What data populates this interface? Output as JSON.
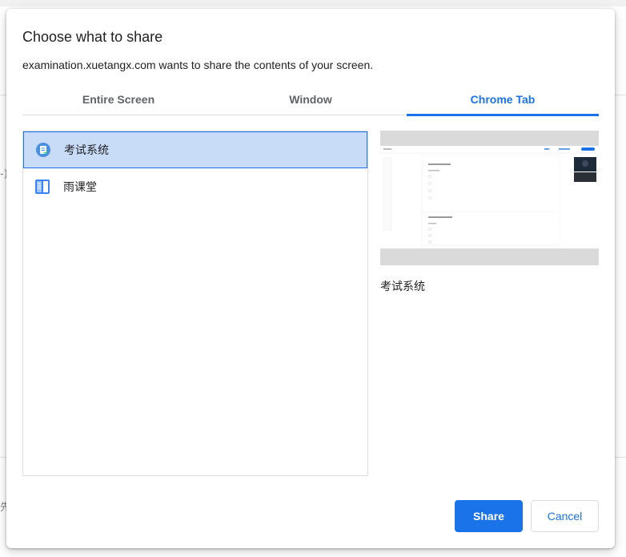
{
  "dialog": {
    "title": "Choose what to share",
    "subtitle": "examination.xuetangx.com wants to share the contents of your screen."
  },
  "tabs": [
    {
      "label": "Entire Screen",
      "active": false
    },
    {
      "label": "Window",
      "active": false
    },
    {
      "label": "Chrome Tab",
      "active": true
    }
  ],
  "list": {
    "items": [
      {
        "label": "考试系统",
        "icon": "exam-system-icon",
        "selected": true
      },
      {
        "label": "雨课堂",
        "icon": "rain-classroom-icon",
        "selected": false
      }
    ]
  },
  "preview": {
    "label": "考试系统"
  },
  "buttons": {
    "share": "Share",
    "cancel": "Cancel"
  },
  "background": {
    "fragment_left_top": "-)",
    "fragment_left_bottom": "先"
  },
  "colors": {
    "accent": "#1a73e8",
    "selected_bg": "#c8dcf8",
    "text": "#202124",
    "muted": "#5f6368"
  }
}
